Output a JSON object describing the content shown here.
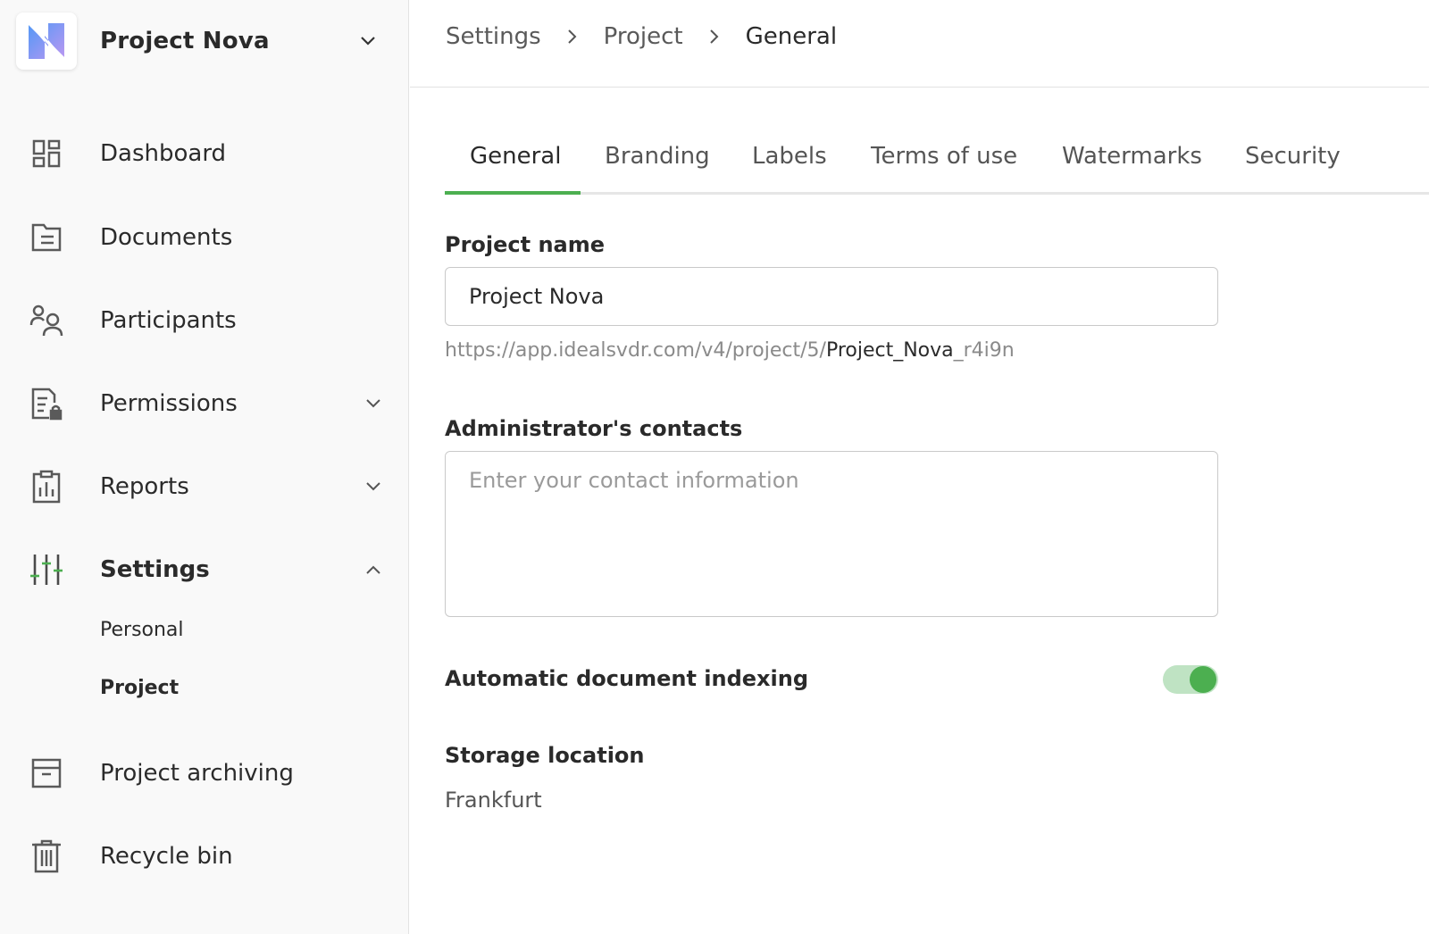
{
  "project": {
    "name": "Project Nova"
  },
  "sidebar": {
    "items": [
      {
        "label": "Dashboard"
      },
      {
        "label": "Documents"
      },
      {
        "label": "Participants"
      },
      {
        "label": "Permissions"
      },
      {
        "label": "Reports"
      },
      {
        "label": "Settings"
      },
      {
        "label": "Project archiving"
      },
      {
        "label": "Recycle bin"
      }
    ],
    "settings_subitems": [
      {
        "label": "Personal"
      },
      {
        "label": "Project"
      }
    ]
  },
  "breadcrumb": [
    "Settings",
    "Project",
    "General"
  ],
  "tabs": [
    "General",
    "Branding",
    "Labels",
    "Terms of use",
    "Watermarks",
    "Security"
  ],
  "form": {
    "project_name_label": "Project name",
    "project_name_value": "Project Nova",
    "url_prefix": "https://app.idealsvdr.com/v4/project/5/",
    "url_slug": "Project_Nova",
    "url_suffix": "_r4i9n",
    "admin_contacts_label": "Administrator's contacts",
    "admin_contacts_placeholder": "Enter your contact information",
    "auto_indexing_label": "Automatic document indexing",
    "auto_indexing_enabled": true,
    "storage_label": "Storage location",
    "storage_value": "Frankfurt"
  },
  "colors": {
    "accent": "#4caf50",
    "toggle_track": "#bfe3c3",
    "logo_gradient": [
      "#3f8cf5",
      "#b48cf0"
    ]
  }
}
